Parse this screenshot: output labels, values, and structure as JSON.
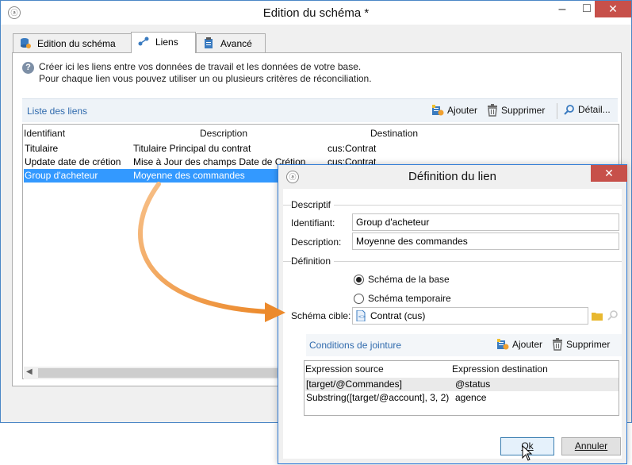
{
  "main_window": {
    "title": "Edition du schéma *",
    "tabs": [
      {
        "label": "Edition du schéma",
        "icon": "database-icon"
      },
      {
        "label": "Liens",
        "icon": "link-icon"
      },
      {
        "label": "Avancé",
        "icon": "clipboard-icon"
      }
    ],
    "info_line1": "Créer ici les liens entre vos données de travail et les données de votre base.",
    "info_line2": "Pour chaque lien vous pouvez utiliser un ou plusieurs critères de réconciliation.",
    "links_section_title": "Liste des liens",
    "toolbar": {
      "add": "Ajouter",
      "delete": "Supprimer",
      "detail": "Détail..."
    },
    "columns": [
      "Identifiant",
      "Description",
      "Destination"
    ],
    "rows": [
      {
        "id": "Titulaire",
        "description": "Titulaire Principal du contrat",
        "destination": "cus:Contrat"
      },
      {
        "id": "Update date de crétion",
        "description": "Mise à Jour des champs Date de Crétion",
        "destination": "cus:Contrat"
      },
      {
        "id": "Group d'acheteur",
        "description": "Moyenne des commandes",
        "destination": ""
      }
    ],
    "selected_row": 2
  },
  "dialog": {
    "title": "Définition du lien",
    "group_descriptif": "Descriptif",
    "label_identifiant": "Identifiant:",
    "value_identifiant": "Group d'acheteur",
    "label_description": "Description:",
    "value_description": "Moyenne des commandes",
    "group_definition": "Définition",
    "radio_base": "Schéma de la base",
    "radio_temp": "Schéma temporaire",
    "radio_selected": "base",
    "label_schema_cible": "Schéma cible:",
    "value_schema_cible": "Contrat (cus)",
    "join_section_title": "Conditions de jointure",
    "join_add": "Ajouter",
    "join_delete": "Supprimer",
    "join_columns": [
      "Expression source",
      "Expression destination"
    ],
    "join_rows": [
      {
        "source": "[target/@Commandes]",
        "destination": "@status"
      },
      {
        "source": "Substring([target/@account], 3, 2)",
        "destination": "agence"
      }
    ],
    "ok_label": "Ok",
    "cancel_label": "Annuler"
  },
  "colors": {
    "accent": "#2f6aad",
    "selection": "#3399ff",
    "arrow": "#f0a048",
    "close": "#c7504a"
  }
}
